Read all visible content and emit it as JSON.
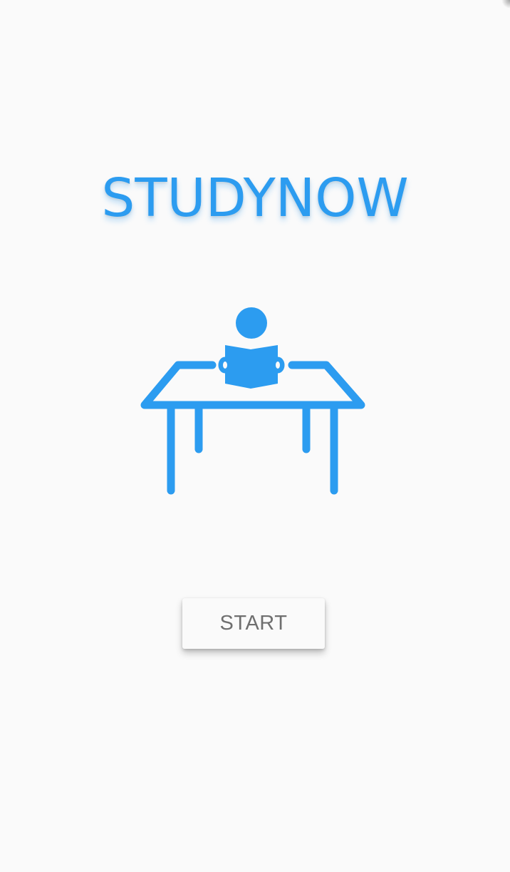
{
  "app": {
    "title": "STUDYNOW",
    "accent_color": "#2c9cf0",
    "background_color": "#fafafa"
  },
  "illustration": {
    "icon": "person-reading-at-desk-icon"
  },
  "actions": {
    "start_label": "START"
  }
}
